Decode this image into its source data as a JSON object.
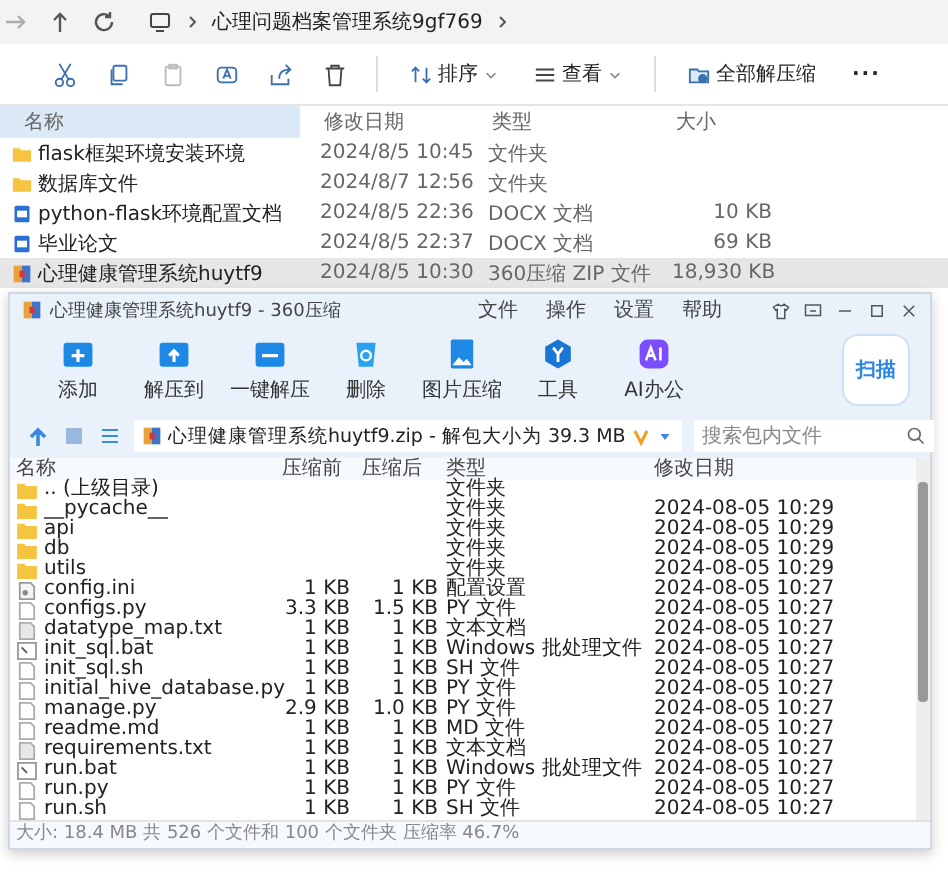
{
  "explorer": {
    "path": "心理问题档案管理系统9gf769",
    "toolbar": [
      "排序",
      "查看",
      "全部解压缩"
    ],
    "more": "···",
    "columns": [
      "名称",
      "修改日期",
      "类型",
      "大小"
    ],
    "rows": [
      {
        "kind": "folder",
        "name": "flask框架环境安装环境",
        "date": "2024/8/5 10:45",
        "type": "文件夹",
        "size": "",
        "selected": false
      },
      {
        "kind": "folder",
        "name": "数据库文件",
        "date": "2024/8/7 12:56",
        "type": "文件夹",
        "size": "",
        "selected": false
      },
      {
        "kind": "docx",
        "name": "python-flask环境配置文档",
        "date": "2024/8/5 22:36",
        "type": "DOCX 文档",
        "size": "10 KB",
        "selected": false
      },
      {
        "kind": "docx",
        "name": "毕业论文",
        "date": "2024/8/5 22:37",
        "type": "DOCX 文档",
        "size": "69 KB",
        "selected": false
      },
      {
        "kind": "zip",
        "name": "心理健康管理系统huytf9",
        "date": "2024/8/5 10:30",
        "type": "360压缩 ZIP 文件",
        "size": "18,930 KB",
        "selected": true
      }
    ]
  },
  "archiver": {
    "title": "心理健康管理系统huytf9 - 360压缩",
    "menus": [
      "文件",
      "操作",
      "设置",
      "帮助"
    ],
    "tools": [
      "添加",
      "解压到",
      "一键解压",
      "删除",
      "图片压缩",
      "工具",
      "AI办公"
    ],
    "scan": "扫描",
    "path": "心理健康管理系统huytf9.zip - 解包大小为 39.3 MB",
    "search": {
      "placeholder": "搜索包内文件"
    },
    "columns": [
      "名称",
      "压缩前",
      "压缩后",
      "类型",
      "修改日期"
    ],
    "rows": [
      {
        "kind": "folder",
        "name": ".. (上级目录)",
        "before": "",
        "after": "",
        "type": "文件夹",
        "date": ""
      },
      {
        "kind": "folder",
        "name": "__pycache__",
        "before": "",
        "after": "",
        "type": "文件夹",
        "date": "2024-08-05 10:29"
      },
      {
        "kind": "folder",
        "name": "api",
        "before": "",
        "after": "",
        "type": "文件夹",
        "date": "2024-08-05 10:29"
      },
      {
        "kind": "folder",
        "name": "db",
        "before": "",
        "after": "",
        "type": "文件夹",
        "date": "2024-08-05 10:29"
      },
      {
        "kind": "folder",
        "name": "utils",
        "before": "",
        "after": "",
        "type": "文件夹",
        "date": "2024-08-05 10:29"
      },
      {
        "kind": "config",
        "name": "config.ini",
        "before": "1 KB",
        "after": "1 KB",
        "type": "配置设置",
        "date": "2024-08-05 10:27"
      },
      {
        "kind": "file",
        "name": "configs.py",
        "before": "3.3 KB",
        "after": "1.5 KB",
        "type": "PY 文件",
        "date": "2024-08-05 10:27"
      },
      {
        "kind": "text",
        "name": "datatype_map.txt",
        "before": "1 KB",
        "after": "1 KB",
        "type": "文本文档",
        "date": "2024-08-05 10:27"
      },
      {
        "kind": "batch",
        "name": "init_sql.bat",
        "before": "1 KB",
        "after": "1 KB",
        "type": "Windows 批处理文件",
        "date": "2024-08-05 10:27"
      },
      {
        "kind": "file",
        "name": "init_sql.sh",
        "before": "1 KB",
        "after": "1 KB",
        "type": "SH 文件",
        "date": "2024-08-05 10:27"
      },
      {
        "kind": "file",
        "name": "initial_hive_database.py",
        "before": "1 KB",
        "after": "1 KB",
        "type": "PY 文件",
        "date": "2024-08-05 10:27"
      },
      {
        "kind": "file",
        "name": "manage.py",
        "before": "2.9 KB",
        "after": "1.0 KB",
        "type": "PY 文件",
        "date": "2024-08-05 10:27"
      },
      {
        "kind": "file",
        "name": "readme.md",
        "before": "1 KB",
        "after": "1 KB",
        "type": "MD 文件",
        "date": "2024-08-05 10:27"
      },
      {
        "kind": "text",
        "name": "requirements.txt",
        "before": "1 KB",
        "after": "1 KB",
        "type": "文本文档",
        "date": "2024-08-05 10:27"
      },
      {
        "kind": "batch",
        "name": "run.bat",
        "before": "1 KB",
        "after": "1 KB",
        "type": "Windows 批处理文件",
        "date": "2024-08-05 10:27"
      },
      {
        "kind": "file",
        "name": "run.py",
        "before": "1 KB",
        "after": "1 KB",
        "type": "PY 文件",
        "date": "2024-08-05 10:27"
      },
      {
        "kind": "file",
        "name": "run.sh",
        "before": "1 KB",
        "after": "1 KB",
        "type": "SH 文件",
        "date": "2024-08-05 10:27"
      }
    ],
    "status": "大小: 18.4 MB 共 526 个文件和 100 个文件夹 压缩率 46.7%"
  }
}
